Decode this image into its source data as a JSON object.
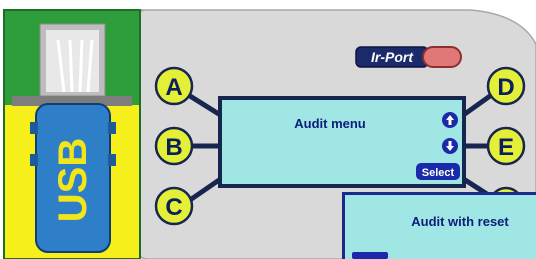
{
  "device": {
    "usb_label": "USB",
    "ir_port_label": "Ir-Port",
    "buttons": {
      "a": "A",
      "b": "B",
      "c": "C",
      "d": "D",
      "e": "E"
    }
  },
  "display": {
    "title": "Audit menu",
    "select_label": "Select",
    "up_icon": "arrow-up-icon",
    "down_icon": "arrow-down-icon"
  },
  "popup": {
    "title": "Audit with reset"
  },
  "colors": {
    "panel_grey": "#d9d9d9",
    "usb_green": "#2e9e3c",
    "usb_yellow": "#f7ef1c",
    "usb_stick_blue": "#2f7fc8",
    "button_yellow": "#e4f038",
    "lcd_cyan": "#9fe6e4",
    "lcd_frame": "#16264f",
    "ir_port_red": "#e07878",
    "ir_badge_navy": "#1a2a6a",
    "popup_border": "#1b2a8a"
  }
}
